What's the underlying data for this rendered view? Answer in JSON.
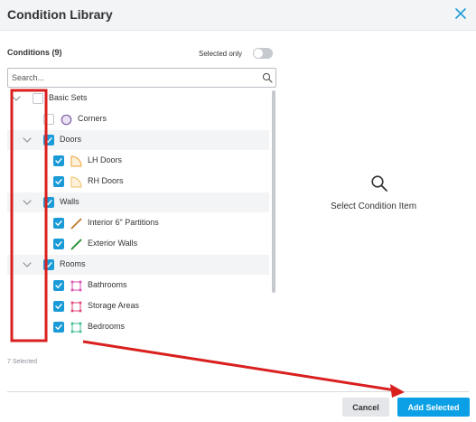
{
  "dialog": {
    "title": "Condition Library",
    "close_icon": "close-icon"
  },
  "conditions": {
    "label": "Conditions (9)",
    "selected_only_label": "Selected only",
    "selected_only_on": false,
    "search_placeholder": "Search...",
    "search_value": "",
    "selected_count_text": "7 Selected",
    "items": [
      {
        "label": "Basic Sets",
        "kind": "group",
        "checked": false,
        "expanded": true,
        "icon": "chevron-down-icon"
      },
      {
        "label": "Corners",
        "kind": "leaf",
        "checked": false,
        "icon": "corner-circle-icon",
        "color": "#7b5ea7"
      },
      {
        "label": "Doors",
        "kind": "group",
        "checked": true,
        "expanded": true,
        "icon": "chevron-down-icon"
      },
      {
        "label": "LH Doors",
        "kind": "leaf",
        "checked": true,
        "icon": "door-arc-icon",
        "color": "#f0a030"
      },
      {
        "label": "RH Doors",
        "kind": "leaf",
        "checked": true,
        "icon": "door-arc-icon",
        "color": "#f0c060"
      },
      {
        "label": "Walls",
        "kind": "group",
        "checked": true,
        "expanded": true,
        "icon": "chevron-down-icon"
      },
      {
        "label": "Interior 6\" Partitions",
        "kind": "leaf",
        "checked": true,
        "icon": "line-icon",
        "color": "#c0762a"
      },
      {
        "label": "Exterior Walls",
        "kind": "leaf",
        "checked": true,
        "icon": "line-icon",
        "color": "#1c8a2a"
      },
      {
        "label": "Rooms",
        "kind": "group",
        "checked": true,
        "expanded": true,
        "icon": "chevron-down-icon"
      },
      {
        "label": "Bathrooms",
        "kind": "leaf",
        "checked": true,
        "icon": "area-square-icon",
        "color": "#d94fb3"
      },
      {
        "label": "Storage Areas",
        "kind": "leaf",
        "checked": true,
        "icon": "area-square-icon",
        "color": "#e0457a"
      },
      {
        "label": "Bedrooms",
        "kind": "leaf",
        "checked": true,
        "icon": "area-square-icon",
        "color": "#3fbf8f"
      }
    ]
  },
  "detail": {
    "icon": "search-icon",
    "label": "Select Condition Item"
  },
  "footer": {
    "cancel_label": "Cancel",
    "add_label": "Add Selected"
  },
  "colors": {
    "accent": "#0b9fe6",
    "checkbox": "#1a9bd7",
    "annotation": "#d9201f"
  }
}
